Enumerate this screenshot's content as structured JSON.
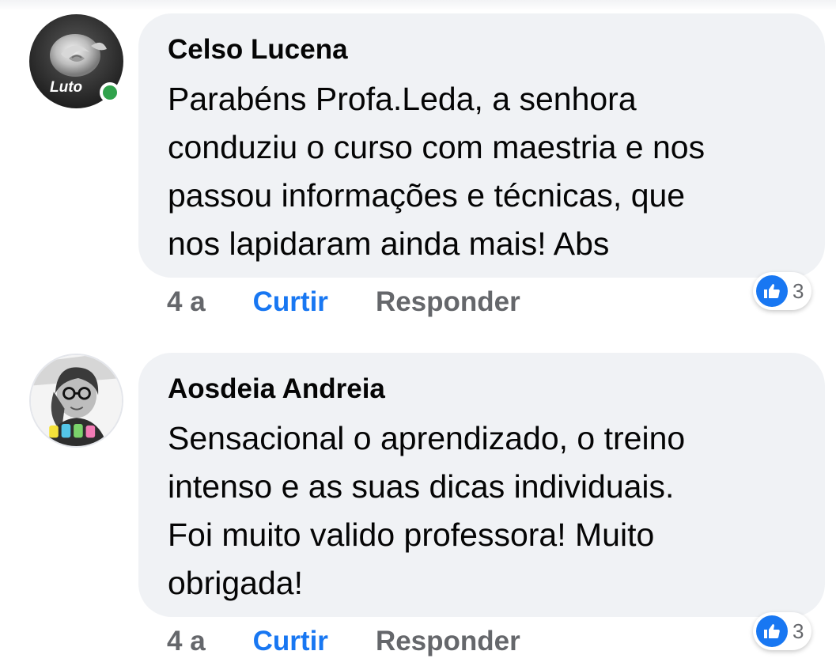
{
  "comments": [
    {
      "author": "Celso Lucena",
      "text": "Parabéns Profa.Leda, a senhora\nconduziu o curso com maestria e nos\npassou informações e técnicas, que\nnos lapidaram ainda mais! Abs",
      "avatar_label": "Luto",
      "online": true,
      "time": "4 a",
      "like_label": "Curtir",
      "reply_label": "Responder",
      "reaction_count": "3"
    },
    {
      "author": "Aosdeia Andreia",
      "text": "Sensacional o aprendizado, o treino\nintenso e as suas dicas individuais.\nFoi muito valido professora! Muito\nobrigada!",
      "online": false,
      "time": "4 a",
      "like_label": "Curtir",
      "reply_label": "Responder",
      "reaction_count": "3"
    }
  ],
  "colors": {
    "bubble": "#f0f2f5",
    "like_blue": "#1877f2",
    "muted_text": "#65676b",
    "online_green": "#31a24c"
  },
  "icons": {
    "reaction": "thumbs-up-icon",
    "presence": "online-status-dot"
  }
}
